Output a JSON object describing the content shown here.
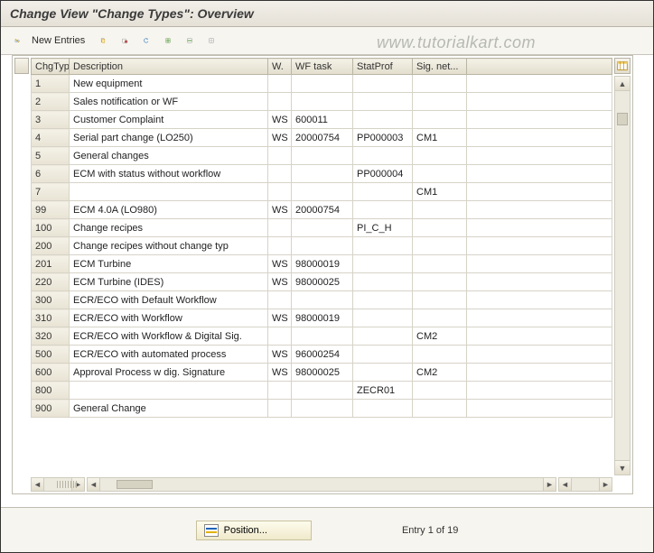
{
  "title": "Change View \"Change Types\": Overview",
  "watermark": "www.tutorialkart.com",
  "toolbar": {
    "new_entries_label": "New Entries"
  },
  "columns": {
    "chgtyp": "ChgTyp",
    "description": "Description",
    "w": "W.",
    "wf_task": "WF task",
    "statprof": "StatProf",
    "sig_net": "Sig. net..."
  },
  "rows": [
    {
      "chg": "1",
      "desc": "New equipment",
      "w": "",
      "wf": "",
      "stat": "",
      "sig": ""
    },
    {
      "chg": "2",
      "desc": "Sales notification or WF",
      "w": "",
      "wf": "",
      "stat": "",
      "sig": ""
    },
    {
      "chg": "3",
      "desc": "Customer Complaint",
      "w": "WS",
      "wf": "600011",
      "stat": "",
      "sig": ""
    },
    {
      "chg": "4",
      "desc": "Serial part change (LO250)",
      "w": "WS",
      "wf": "20000754",
      "stat": "PP000003",
      "sig": "CM1"
    },
    {
      "chg": "5",
      "desc": "General changes",
      "w": "",
      "wf": "",
      "stat": "",
      "sig": ""
    },
    {
      "chg": "6",
      "desc": "ECM with status without workflow",
      "w": "",
      "wf": "",
      "stat": "PP000004",
      "sig": ""
    },
    {
      "chg": "7",
      "desc": "",
      "w": "",
      "wf": "",
      "stat": "",
      "sig": "CM1"
    },
    {
      "chg": "99",
      "desc": "ECM 4.0A (LO980)",
      "w": "WS",
      "wf": "20000754",
      "stat": "",
      "sig": ""
    },
    {
      "chg": "100",
      "desc": "Change recipes",
      "w": "",
      "wf": "",
      "stat": "PI_C_H",
      "sig": ""
    },
    {
      "chg": "200",
      "desc": "Change recipes without change typ",
      "w": "",
      "wf": "",
      "stat": "",
      "sig": ""
    },
    {
      "chg": "201",
      "desc": "ECM Turbine",
      "w": "WS",
      "wf": "98000019",
      "stat": "",
      "sig": ""
    },
    {
      "chg": "220",
      "desc": "ECM Turbine (IDES)",
      "w": "WS",
      "wf": "98000025",
      "stat": "",
      "sig": ""
    },
    {
      "chg": "300",
      "desc": "ECR/ECO with Default Workflow",
      "w": "",
      "wf": "",
      "stat": "",
      "sig": ""
    },
    {
      "chg": "310",
      "desc": "ECR/ECO with Workflow",
      "w": "WS",
      "wf": "98000019",
      "stat": "",
      "sig": ""
    },
    {
      "chg": "320",
      "desc": "ECR/ECO with Workflow  & Digital Sig.",
      "w": "",
      "wf": "",
      "stat": "",
      "sig": "CM2"
    },
    {
      "chg": "500",
      "desc": "ECR/ECO with automated process",
      "w": "WS",
      "wf": "96000254",
      "stat": "",
      "sig": ""
    },
    {
      "chg": "600",
      "desc": "Approval Process w dig. Signature",
      "w": "WS",
      "wf": "98000025",
      "stat": "",
      "sig": "CM2"
    },
    {
      "chg": "800",
      "desc": "",
      "w": "",
      "wf": "",
      "stat": "ZECR01",
      "sig": ""
    },
    {
      "chg": "900",
      "desc": "General Change",
      "w": "",
      "wf": "",
      "stat": "",
      "sig": ""
    }
  ],
  "footer": {
    "position_label": "Position...",
    "entry_label": "Entry 1 of 19"
  }
}
